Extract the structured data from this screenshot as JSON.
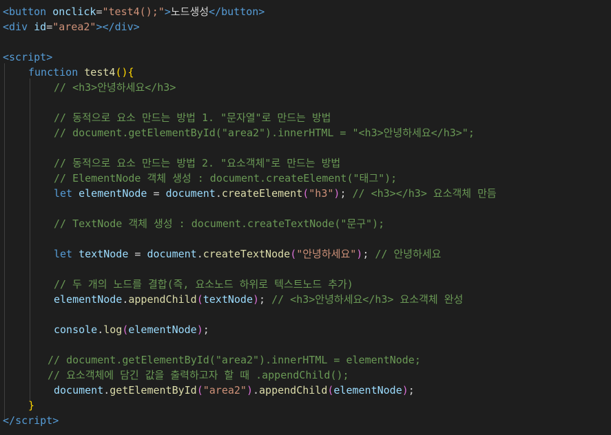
{
  "editor": {
    "lines": {
      "l1": [
        "<",
        "button",
        " ",
        "onclick",
        "=",
        "\"test4();\"",
        ">",
        "노드생성",
        "</",
        "button",
        ">"
      ],
      "l2": [
        "<",
        "div",
        " ",
        "id",
        "=",
        "\"area2\"",
        "></",
        "div",
        ">"
      ],
      "l4": [
        "<",
        "script",
        ">"
      ],
      "l5": [
        "function",
        " ",
        "test4",
        "(",
        ")",
        "{"
      ],
      "l6": [
        "// <h3>안녕하세요</h3>"
      ],
      "l8": [
        "// 동적으로 요소 만드는 방법 1. \"문자열\"로 만드는 방법"
      ],
      "l9": [
        "// document.getElementById(\"area2\").innerHTML = \"<h3>안녕하세요</h3>\";"
      ],
      "l11": [
        "// 동적으로 요소 만드는 방법 2. \"요소객체\"로 만드는 방법"
      ],
      "l12": [
        "// ElementNode 객체 생성 : document.createElement(\"태그\");"
      ],
      "l13": [
        "let",
        " ",
        "elementNode",
        " = ",
        "document",
        ".",
        "createElement",
        "(",
        "\"h3\"",
        ")",
        "; ",
        "// <h3></h3> 요소객체 만듬"
      ],
      "l15": [
        "// TextNode 객체 생성 : document.createTextNode(\"문구\");"
      ],
      "l17": [
        "let",
        " ",
        "textNode",
        " = ",
        "document",
        ".",
        "createTextNode",
        "(",
        "\"안녕하세요\"",
        ")",
        "; ",
        "// 안녕하세요"
      ],
      "l19": [
        "// 두 개의 노드를 결합(즉, 요소노드 하위로 텍스트노드 추가)"
      ],
      "l20": [
        "elementNode",
        ".",
        "appendChild",
        "(",
        "textNode",
        ")",
        "; ",
        "// <h3>안녕하세요</h3> 요소객체 완성"
      ],
      "l22": [
        "console",
        ".",
        "log",
        "(",
        "elementNode",
        ")",
        ";"
      ],
      "l24": [
        "// document.getElementById(\"area2\").innerHTML = elementNode;"
      ],
      "l25": [
        "// 요소객체에 담긴 값을 출력하고자 할 때 .appendChild();"
      ],
      "l26": [
        "document",
        ".",
        "getElementById",
        "(",
        "\"area2\"",
        ")",
        ".",
        "appendChild",
        "(",
        "elementNode",
        ")",
        ";"
      ],
      "l27": [
        "}"
      ],
      "l28": [
        "</",
        "script",
        ">"
      ]
    }
  }
}
